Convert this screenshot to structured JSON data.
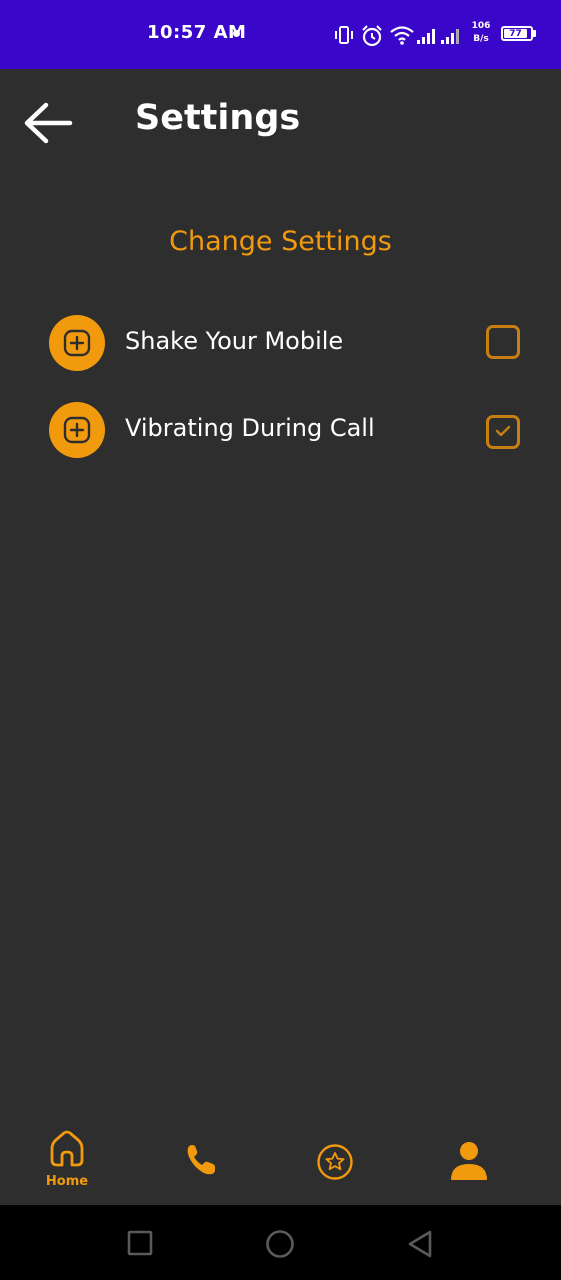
{
  "status_bar": {
    "time": "10:57 AM",
    "net_speed_value": "106",
    "net_speed_unit": "B/s",
    "battery": "77",
    "background_color": "#3a06c9"
  },
  "header": {
    "title": "Settings",
    "back_icon": "arrow-left-icon"
  },
  "section": {
    "title": "Change Settings",
    "accent_color": "#f29a0e"
  },
  "settings": [
    {
      "label": "Shake Your Mobile",
      "icon": "plus-square-icon",
      "checked": false
    },
    {
      "label": "Vibrating During Call",
      "icon": "plus-square-icon",
      "checked": true
    }
  ],
  "bottom_nav": {
    "items": [
      {
        "icon": "home-icon",
        "label": "Home",
        "active": true
      },
      {
        "icon": "phone-icon"
      },
      {
        "icon": "star-circle-icon"
      },
      {
        "icon": "user-icon"
      }
    ]
  },
  "system_nav": {
    "items": [
      "recent-apps-icon",
      "home-circle-icon",
      "back-triangle-icon"
    ]
  }
}
